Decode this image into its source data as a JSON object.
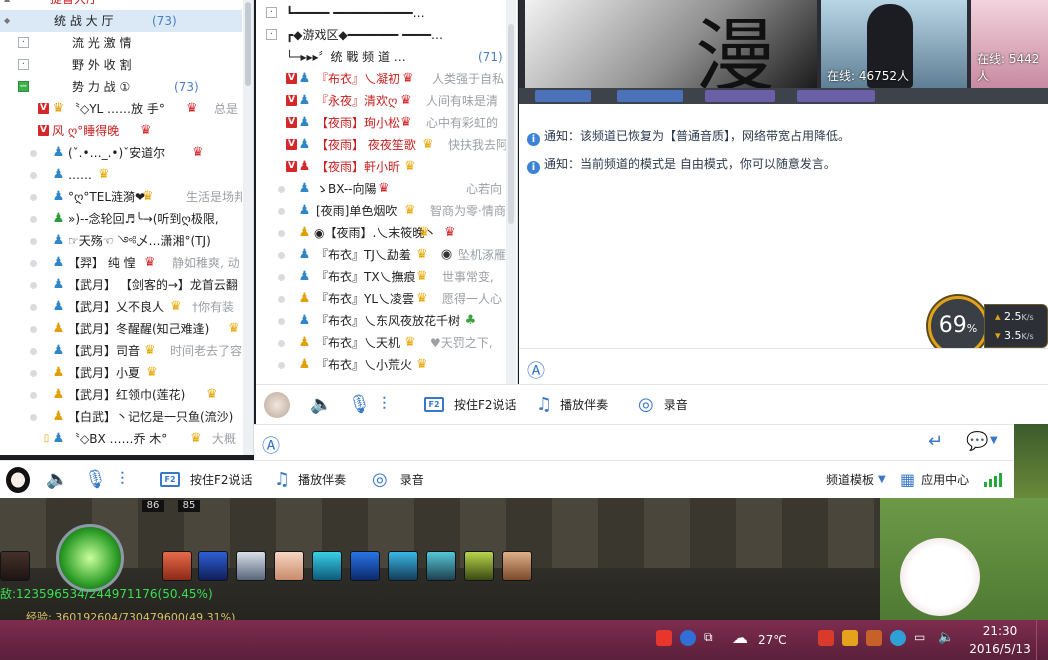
{
  "left_list": {
    "rows": [
      {
        "label": "提督大厅",
        "count": ""
      },
      {
        "label": "统 战 大 厅",
        "count": "(73)"
      },
      {
        "label": "流 光 激 情",
        "count": ""
      },
      {
        "label": "野 外 收 割",
        "count": ""
      },
      {
        "label": "势 力 战 ①",
        "count": "(73)"
      }
    ],
    "users": [
      {
        "name": "〝◇YL ……放 手°",
        "sig": "总是"
      },
      {
        "name": "风 ღ°睡得晚",
        "sig": ""
      },
      {
        "name": "(ˇ.•…_.•)ˇ安道尔",
        "sig": ""
      },
      {
        "name": "……",
        "sig": ""
      },
      {
        "name": "°ღ°TEL涟漪❤",
        "sig": "生活是场邦"
      },
      {
        "name": "»)--念轮回♬╰→(听到ღ极限,",
        "sig": ""
      },
      {
        "name": "☞天殇☜ ༺乄…潇湘°(TJ)",
        "sig": ""
      },
      {
        "name": "【羿】 纯 惶",
        "sig": "静如稚爽, 动"
      },
      {
        "name": "【武月】 【剑客的→】龙首云翻",
        "sig": ""
      },
      {
        "name": "【武月】乂不良人",
        "sig": "†你有装"
      },
      {
        "name": "【武月】冬醒醒(知己难逢)",
        "sig": ""
      },
      {
        "name": "【武月】司音",
        "sig": "时间老去了容"
      },
      {
        "name": "【武月】小夏",
        "sig": ""
      },
      {
        "name": "【武月】红领巾(莲花)",
        "sig": ""
      },
      {
        "name": "【白武】丶记忆是一只鱼(流沙)",
        "sig": ""
      },
      {
        "name": "〝◇BX ……乔 木°",
        "sig": "大概"
      }
    ]
  },
  "mid_list": {
    "headers": [
      {
        "label": "┗━━━━━ ━━━━━━━━━━━…"
      },
      {
        "label": "┏◆游戏区◆━━━━━━━ ━━━━…"
      },
      {
        "label": "└─▸▸▸〞统 戰 频 道 …",
        "count": "(71)"
      }
    ],
    "users": [
      {
        "name": "『布衣』乀凝初",
        "sig": "人类强于自私"
      },
      {
        "name": "『永夜』清欢ღ",
        "sig": "人间有味是清"
      },
      {
        "name": "【夜雨】珣小松",
        "sig": "心中有彩虹的"
      },
      {
        "name": "【夜雨】 夜夜笙歌",
        "sig": "快扶我去阿"
      },
      {
        "name": "【夜雨】軒小昕",
        "sig": ""
      },
      {
        "name": "ゝBX--向陽",
        "sig": "心若向"
      },
      {
        "name": "[夜雨]单色烟吹",
        "sig": "智商为零·情商"
      },
      {
        "name": "◉【夜雨】.乀末筱晚丶",
        "sig": ""
      },
      {
        "name": "『布衣』TJ乀勐羞",
        "sig": "坠机涿雁"
      },
      {
        "name": "『布衣』TX乀撫痕",
        "sig": "世事常变,"
      },
      {
        "name": "『布衣』YL乀凌雲",
        "sig": "愿得一人心"
      },
      {
        "name": "『布衣』乀东风夜放花千树",
        "sig": ""
      },
      {
        "name": "『布衣』乀天机",
        "sig": "♥天罚之下,"
      },
      {
        "name": "『布衣』乀小荒火",
        "sig": ""
      }
    ]
  },
  "video": {
    "tiles": [
      {
        "label": "在线: 46752人"
      },
      {
        "label": "在线: 5442人"
      }
    ],
    "banner_text": "漫"
  },
  "chat": {
    "notices": [
      {
        "label": "通知：",
        "text": "该频道已恢复为【普通音质】，网络带宽占用降低。"
      },
      {
        "label": "通知：",
        "text": "当前频道的模式是 自由模式，你可以随意发言。"
      }
    ]
  },
  "speed": {
    "percent": "69",
    "percent_unit": "%",
    "up": "2.5",
    "down": "3.5",
    "unit": "K/s"
  },
  "toolbar": {
    "push_to_talk": "按住F2说话",
    "play_music": "播放伴奏",
    "record": "录音",
    "channel_template": "频道模板",
    "app_center": "应用中心",
    "f2": "F2"
  },
  "game": {
    "hp_text": "敌:123596534/244971176(50.45%)",
    "exp_text": "经验: 360192604/730479600(49.31%)",
    "num1": "86",
    "num2": "85"
  },
  "taskbar": {
    "temperature": "27℃",
    "time": "21:30",
    "date": "2016/5/13"
  },
  "colors": {
    "accent_blue": "#3877c9",
    "crown_gold": "#e7a700",
    "vip_red": "#d4282c",
    "taskbar": "#6b2545"
  }
}
